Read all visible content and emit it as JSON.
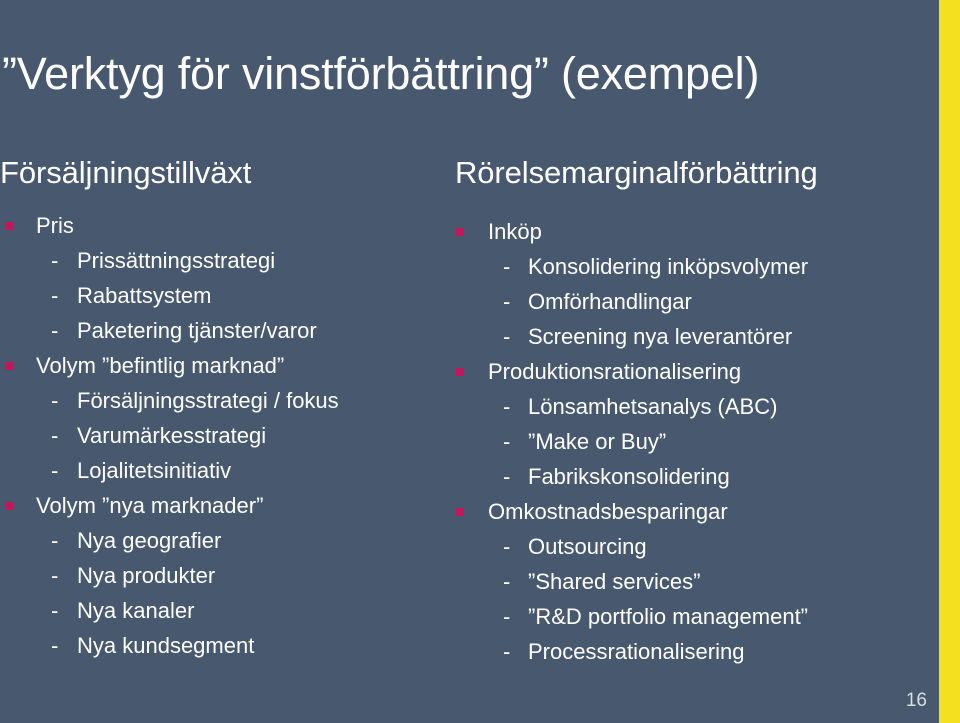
{
  "slide": {
    "title": "”Verktyg för vinstförbättring” (exempel)",
    "number": "16",
    "background_color": "#47586F",
    "accent_stripe_color": "#F5E020",
    "bullet_color": "#C2185B",
    "text_color": "#FFFFFF"
  },
  "columns": [
    {
      "heading": "Försäljningstillväxt",
      "items": [
        {
          "level": 1,
          "text": "Pris"
        },
        {
          "level": 2,
          "text": "Prissättningsstrategi"
        },
        {
          "level": 2,
          "text": "Rabattsystem"
        },
        {
          "level": 2,
          "text": "Paketering tjänster/varor"
        },
        {
          "level": 1,
          "text": "Volym ”befintlig marknad”"
        },
        {
          "level": 2,
          "text": "Försäljningsstrategi / fokus"
        },
        {
          "level": 2,
          "text": "Varumärkesstrategi"
        },
        {
          "level": 2,
          "text": "Lojalitetsinitiativ"
        },
        {
          "level": 1,
          "text": "Volym ”nya marknader”"
        },
        {
          "level": 2,
          "text": "Nya geografier"
        },
        {
          "level": 2,
          "text": "Nya produkter"
        },
        {
          "level": 2,
          "text": "Nya kanaler"
        },
        {
          "level": 2,
          "text": "Nya kundsegment"
        }
      ]
    },
    {
      "heading": "Rörelsemarginalförbättring",
      "items": [
        {
          "level": 1,
          "text": "Inköp"
        },
        {
          "level": 2,
          "text": "Konsolidering inköpsvolymer"
        },
        {
          "level": 2,
          "text": "Omförhandlingar"
        },
        {
          "level": 2,
          "text": "Screening nya leverantörer"
        },
        {
          "level": 1,
          "text": "Produktionsrationalisering"
        },
        {
          "level": 2,
          "text": "Lönsamhetsanalys (ABC)"
        },
        {
          "level": 2,
          "text": "”Make or Buy”"
        },
        {
          "level": 2,
          "text": "Fabrikskonsolidering"
        },
        {
          "level": 1,
          "text": "Omkostnadsbesparingar"
        },
        {
          "level": 2,
          "text": "Outsourcing"
        },
        {
          "level": 2,
          "text": "”Shared services”"
        },
        {
          "level": 2,
          "text": "”R&D portfolio management”"
        },
        {
          "level": 2,
          "text": "Processrationalisering"
        }
      ]
    }
  ],
  "symbols": {
    "dash": "-"
  }
}
